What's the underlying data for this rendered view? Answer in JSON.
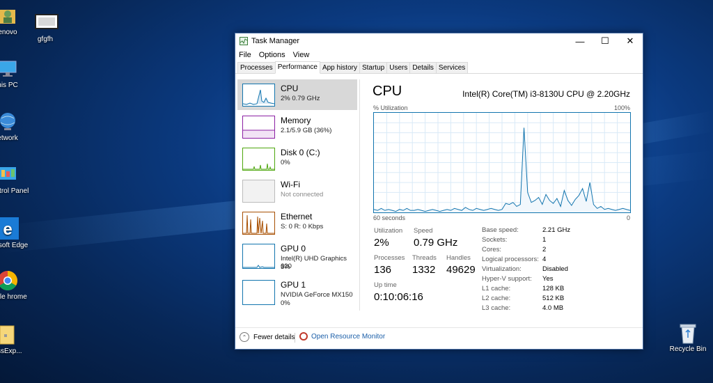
{
  "desktop": {
    "icons": [
      {
        "label": "enovo",
        "icon": "user-folder-icon"
      },
      {
        "label": "gfgfh",
        "icon": "document-icon"
      },
      {
        "label": "his PC",
        "icon": "computer-icon"
      },
      {
        "label": "etwork",
        "icon": "network-icon"
      },
      {
        "label": "Control Panel",
        "icon": "control-panel-icon"
      },
      {
        "label": "icrosoft Edge",
        "icon": "edge-icon"
      },
      {
        "label": "oogle hrome",
        "icon": "chrome-icon"
      },
      {
        "label": "essExp...",
        "icon": "folder-icon"
      },
      {
        "label": "Recycle Bin",
        "icon": "recycle-bin-icon"
      }
    ]
  },
  "window": {
    "title": "Task Manager",
    "controls": {
      "minimize": "—",
      "maximize": "☐",
      "close": "✕"
    },
    "menu": [
      "File",
      "Options",
      "View"
    ],
    "tabs": [
      "Processes",
      "Performance",
      "App history",
      "Startup",
      "Users",
      "Details",
      "Services"
    ],
    "active_tab": "Performance"
  },
  "sidebar": [
    {
      "name": "CPU",
      "line1": "2%  0.79 GHz",
      "line2": "",
      "color": "#1174ae"
    },
    {
      "name": "Memory",
      "line1": "2.1/5.9 GB (36%)",
      "line2": "",
      "color": "#8b1fa3"
    },
    {
      "name": "Disk 0 (C:)",
      "line1": "0%",
      "line2": "",
      "color": "#4da60c"
    },
    {
      "name": "Wi-Fi",
      "line1": "Not connected",
      "line2": "",
      "color": "#bbbbbb"
    },
    {
      "name": "Ethernet",
      "line1": "S: 0  R: 0 Kbps",
      "line2": "",
      "color": "#a74f01"
    },
    {
      "name": "GPU 0",
      "line1": "Intel(R) UHD Graphics 620",
      "line2": "3%",
      "color": "#1174ae"
    },
    {
      "name": "GPU 1",
      "line1": "NVIDIA GeForce MX150",
      "line2": "0%",
      "color": "#1174ae"
    }
  ],
  "main": {
    "title": "CPU",
    "model": "Intel(R) Core(TM) i3-8130U CPU @ 2.20GHz",
    "util_label": "% Utilization",
    "util_max": "100%",
    "x_left": "60 seconds",
    "x_right": "0"
  },
  "chart_data": {
    "type": "area",
    "x_label_left": "60 seconds",
    "x_label_right": "0",
    "ylim": [
      0,
      100
    ],
    "values": [
      3,
      2,
      4,
      2,
      3,
      2,
      1,
      3,
      2,
      4,
      2,
      2,
      3,
      2,
      1,
      2,
      3,
      2,
      1,
      2,
      3,
      2,
      4,
      3,
      2,
      5,
      3,
      2,
      4,
      3,
      2,
      3,
      4,
      3,
      2,
      3,
      9,
      8,
      10,
      6,
      8,
      85,
      20,
      10,
      12,
      15,
      8,
      18,
      12,
      9,
      14,
      6,
      22,
      12,
      7,
      13,
      17,
      24,
      11,
      30,
      8,
      4,
      6,
      3,
      4,
      3,
      2,
      3,
      4,
      3,
      2
    ],
    "grid": true,
    "color": "#1174ae"
  },
  "stats": {
    "utilization": {
      "label": "Utilization",
      "value": "2%"
    },
    "speed": {
      "label": "Speed",
      "value": "0.79 GHz"
    },
    "processes": {
      "label": "Processes",
      "value": "136"
    },
    "threads": {
      "label": "Threads",
      "value": "1332"
    },
    "handles": {
      "label": "Handles",
      "value": "49629"
    },
    "uptime": {
      "label": "Up time",
      "value": "0:10:06:16"
    }
  },
  "specs": [
    {
      "label": "Base speed:",
      "value": "2.21 GHz"
    },
    {
      "label": "Sockets:",
      "value": "1"
    },
    {
      "label": "Cores:",
      "value": "2"
    },
    {
      "label": "Logical processors:",
      "value": "4"
    },
    {
      "label": "Virtualization:",
      "value": "Disabled"
    },
    {
      "label": "Hyper-V support:",
      "value": "Yes"
    },
    {
      "label": "L1 cache:",
      "value": "128 KB"
    },
    {
      "label": "L2 cache:",
      "value": "512 KB"
    },
    {
      "label": "L3 cache:",
      "value": "4.0 MB"
    }
  ],
  "footer": {
    "fewer_details": "Fewer details",
    "resource_monitor": "Open Resource Monitor"
  }
}
